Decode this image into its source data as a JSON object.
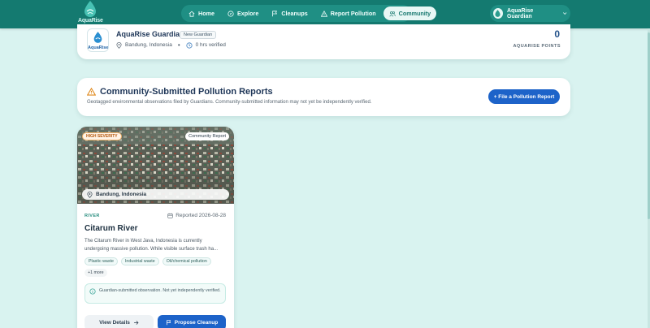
{
  "brand": {
    "name": "AquaRise"
  },
  "nav": {
    "items": [
      {
        "label": "Home",
        "icon": "home-icon",
        "active": false
      },
      {
        "label": "Explore",
        "icon": "compass-icon",
        "active": false
      },
      {
        "label": "Cleanups",
        "icon": "flag-icon",
        "active": false
      },
      {
        "label": "Report Pollution",
        "icon": "warning-icon",
        "active": false
      },
      {
        "label": "Community",
        "icon": "users-icon",
        "active": true
      }
    ]
  },
  "user_menu": {
    "name": "AquaRise Guardian",
    "icon": "chevron-down-icon"
  },
  "profile": {
    "logo_text": "AquaRise",
    "name": "AquaRise Guardian",
    "badge": "New Guardian",
    "location": "Bandung, Indonesia",
    "hours": "0 hrs verified",
    "points_value": "0",
    "points_label": "AQUARISE POINTS"
  },
  "reports_section": {
    "title": "Community-Submitted Pollution Reports",
    "subtitle": "Geotagged environmental observations filed by Guardians. Community-submitted information may not yet be independently verified.",
    "file_button": "+ File a Pollution Report"
  },
  "report_card": {
    "severity": "HIGH SEVERITY",
    "source_badge": "Community Report",
    "location": "Bandung, Indonesia",
    "type": "RIVER",
    "date": "Reported 2026-08-28",
    "title": "Citarum River",
    "description": "The Citarum River in West Java, Indonesia is currently undergoing massive pollution. While visible surface trash ha...",
    "tags": [
      "Plastic waste",
      "Industrial waste",
      "Oil/chemical pollution"
    ],
    "more": "+1 more",
    "notice": "Guardian-submitted observation. Not yet independently verified.",
    "details_button": "View Details",
    "propose_button": "Propose Cleanup"
  },
  "colors": {
    "nav_bg": "#147a70",
    "page_bg": "#d9f3f0",
    "primary_button": "#1d63c9",
    "severity_accent": "#b4570c"
  }
}
